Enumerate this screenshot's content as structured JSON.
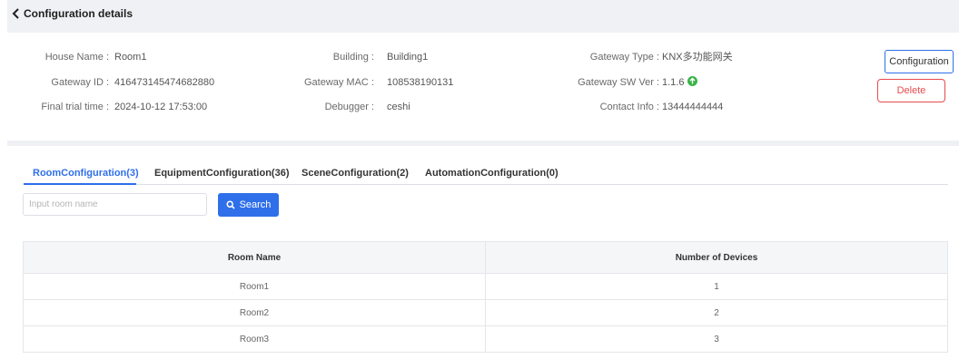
{
  "header": {
    "title": "Configuration details"
  },
  "info": {
    "house_name": {
      "label": "House Name :",
      "value": "Room1"
    },
    "gateway_id": {
      "label": "Gateway ID :",
      "value": "416473145474682880"
    },
    "final_trial_time": {
      "label": "Final trial time :",
      "value": "2024-10-12 17:53:00"
    },
    "building": {
      "label": "Building :",
      "value": "Building1"
    },
    "gateway_mac": {
      "label": "Gateway MAC :",
      "value": "108538190131"
    },
    "debugger": {
      "label": "Debugger :",
      "value": "ceshi"
    },
    "gateway_type": {
      "label": "Gateway Type :",
      "value": "KNX多功能网关"
    },
    "gateway_sw_ver": {
      "label": "Gateway SW Ver :",
      "value": "1.1.6"
    },
    "contact_info": {
      "label": "Contact Info :",
      "value": "13444444444"
    }
  },
  "actions": {
    "configuration_label": "Configuration",
    "delete_label": "Delete"
  },
  "tabs": [
    {
      "label": "RoomConfiguration(3)",
      "active": true
    },
    {
      "label": "EquipmentConfiguration(36)",
      "active": false
    },
    {
      "label": "SceneConfiguration(2)",
      "active": false
    },
    {
      "label": "AutomationConfiguration(0)",
      "active": false
    }
  ],
  "search": {
    "placeholder": "Input room name",
    "value": "",
    "button_label": "Search"
  },
  "table": {
    "columns": [
      "Room Name",
      "Number of Devices"
    ],
    "rows": [
      [
        "Room1",
        "1"
      ],
      [
        "Room2",
        "2"
      ],
      [
        "Room3",
        "3"
      ]
    ]
  },
  "colors": {
    "accent": "#2f6fe9",
    "danger": "#e64b4b",
    "update_badge": "#39b449"
  }
}
